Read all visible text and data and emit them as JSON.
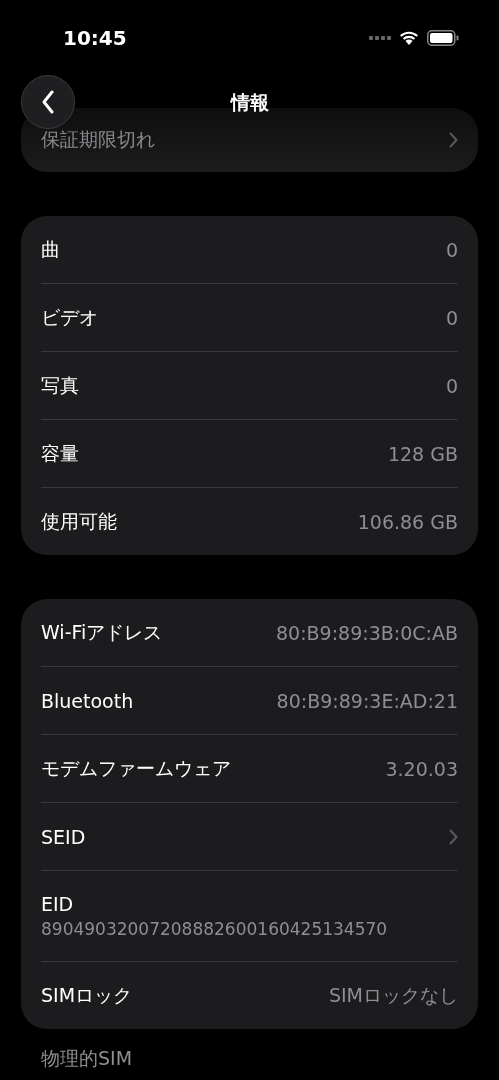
{
  "status_bar": {
    "time": "10:45"
  },
  "nav": {
    "title": "情報"
  },
  "warranty": {
    "label": "保証期限切れ"
  },
  "media_card": {
    "rows": [
      {
        "kind": "value",
        "label": "曲",
        "value": "0"
      },
      {
        "kind": "value",
        "label": "ビデオ",
        "value": "0"
      },
      {
        "kind": "value",
        "label": "写真",
        "value": "0"
      },
      {
        "kind": "value",
        "label": "容量",
        "value": "128 GB"
      },
      {
        "kind": "value",
        "label": "使用可能",
        "value": "106.86 GB"
      }
    ]
  },
  "network_card": {
    "rows": [
      {
        "kind": "value",
        "label": "Wi-Fiアドレス",
        "value": "80:B9:89:3B:0C:AB"
      },
      {
        "kind": "value",
        "label": "Bluetooth",
        "value": "80:B9:89:3E:AD:21"
      },
      {
        "kind": "value",
        "label": "モデムファームウェア",
        "value": "3.20.03"
      },
      {
        "kind": "chevron",
        "label": "SEID"
      },
      {
        "kind": "stacked",
        "label": "EID",
        "value": "89049032007208882600160425134570"
      },
      {
        "kind": "value",
        "label": "SIMロック",
        "value": "SIMロックなし"
      }
    ]
  },
  "section_header": "物理的SIM"
}
